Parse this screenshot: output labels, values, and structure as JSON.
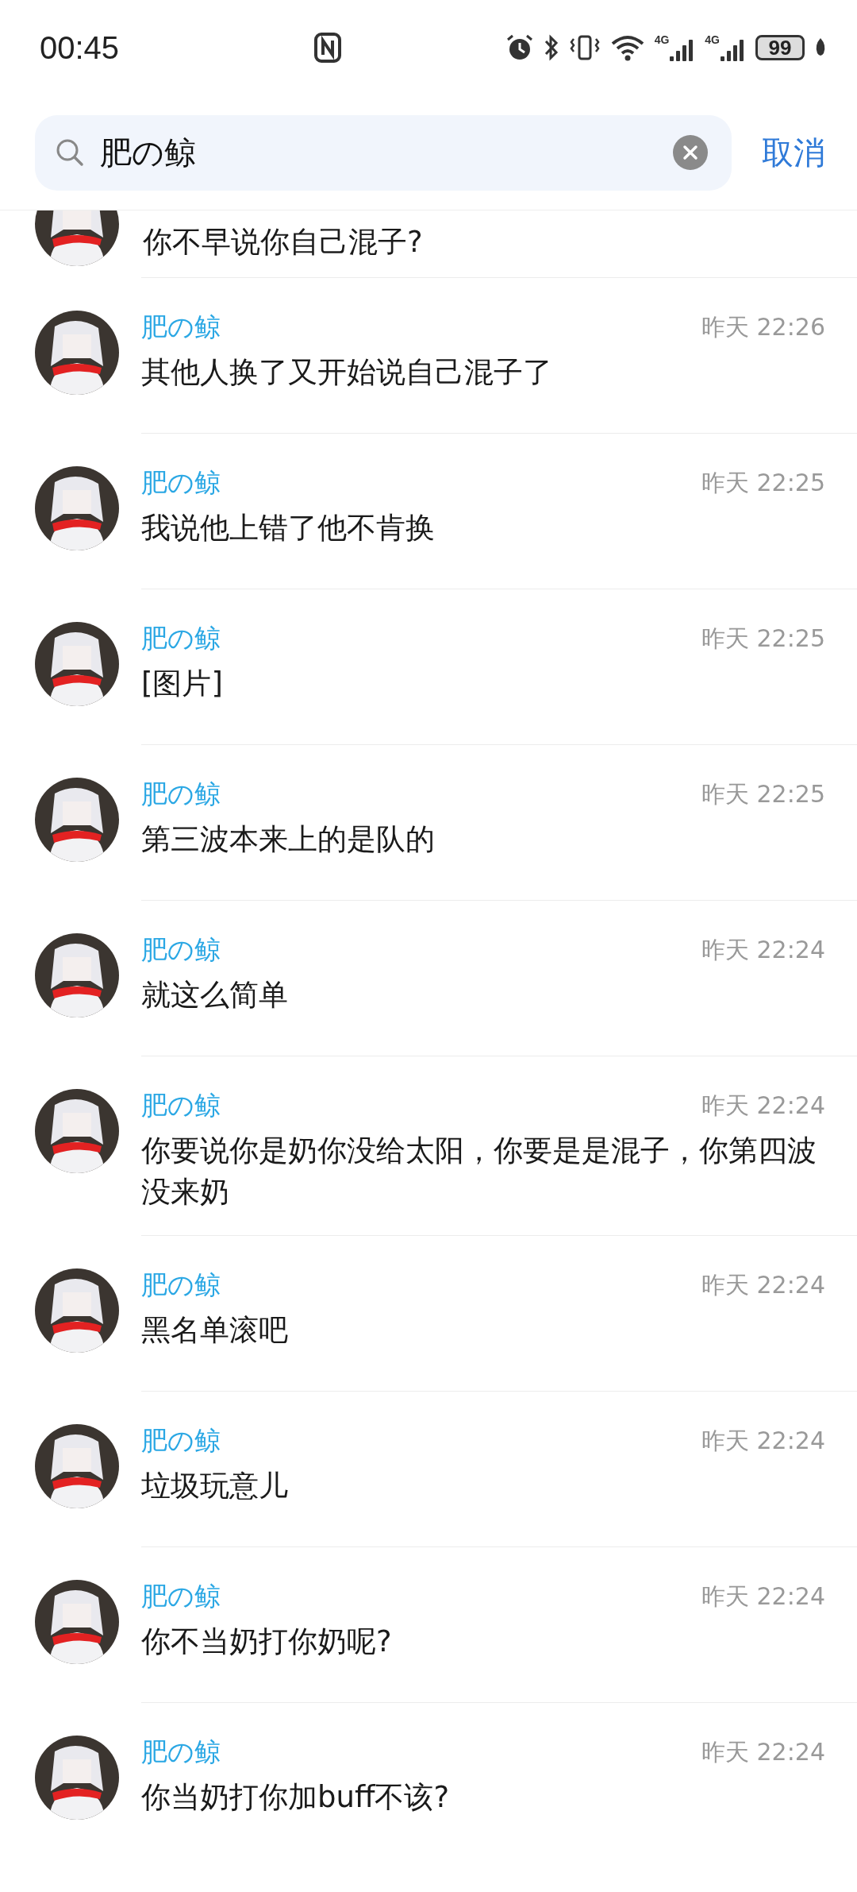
{
  "status_bar": {
    "time": "00:45",
    "networks": [
      "4G",
      "4G"
    ],
    "battery": "99"
  },
  "search": {
    "value": "肥の鲸",
    "cancel": "取消"
  },
  "partial_message": {
    "text": "你不早说你自己混子?"
  },
  "results": [
    {
      "name": "肥の鲸",
      "time": "昨天 22:26",
      "text": "其他人换了又开始说自己混子了"
    },
    {
      "name": "肥の鲸",
      "time": "昨天 22:25",
      "text": "我说他上错了他不肯换"
    },
    {
      "name": "肥の鲸",
      "time": "昨天 22:25",
      "text": "[图片]"
    },
    {
      "name": "肥の鲸",
      "time": "昨天 22:25",
      "text": "第三波本来上的是队的"
    },
    {
      "name": "肥の鲸",
      "time": "昨天 22:24",
      "text": "就这么简单"
    },
    {
      "name": "肥の鲸",
      "time": "昨天 22:24",
      "text": "你要说你是奶你没给太阳，你要是是混子，你第四波没来奶"
    },
    {
      "name": "肥の鲸",
      "time": "昨天 22:24",
      "text": "黑名单滚吧"
    },
    {
      "name": "肥の鲸",
      "time": "昨天 22:24",
      "text": "垃圾玩意儿"
    },
    {
      "name": "肥の鲸",
      "time": "昨天 22:24",
      "text": "你不当奶打你奶呢?"
    },
    {
      "name": "肥の鲸",
      "time": "昨天 22:24",
      "text": "你当奶打你加buff不该?"
    }
  ]
}
